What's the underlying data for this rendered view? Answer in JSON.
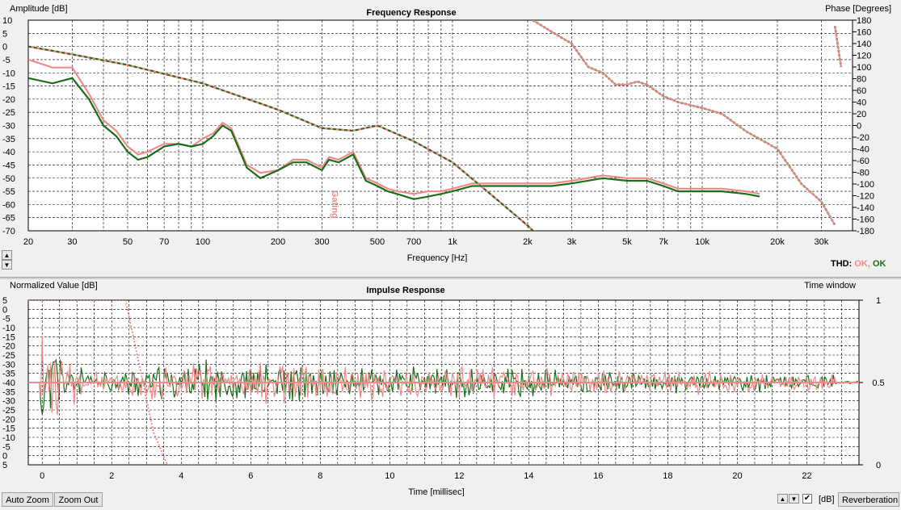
{
  "colors": {
    "series_a": "#f08a8a",
    "series_b": "#1a6e1a",
    "grid": "#000000",
    "background": "#ffffff",
    "window": "#f08a8a",
    "thd_ok_a": "#f08a8a",
    "thd_ok_b": "#1a6e1a"
  },
  "freq": {
    "title": "Frequency Response",
    "ylabel": "Amplitude [dB]",
    "ylabel_right": "Phase [Degrees]",
    "xlabel": "Frequency [Hz]",
    "y_ticks": [
      "10",
      "5",
      "0",
      "-5",
      "-10",
      "-15",
      "-20",
      "-25",
      "-30",
      "-35",
      "-40",
      "-45",
      "-50",
      "-55",
      "-60",
      "-65",
      "-70"
    ],
    "phase_ticks": [
      "180",
      "160",
      "140",
      "120",
      "100",
      "80",
      "60",
      "40",
      "20",
      "0",
      "-20",
      "-40",
      "-60",
      "-80",
      "-100",
      "-120",
      "-140",
      "-160",
      "-180"
    ],
    "x_ticks": [
      "20",
      "30",
      "50",
      "70",
      "100",
      "200",
      "300",
      "500",
      "700",
      "1k",
      "2k",
      "3k",
      "5k",
      "7k",
      "10k",
      "20k",
      "30k"
    ],
    "marker_label": "Gating",
    "thd_label": "THD:",
    "thd_a": "OK,",
    "thd_b": "OK"
  },
  "impulse": {
    "title": "Impulse Response",
    "ylabel": "Normalized Value [dB]",
    "ylabel_right": "Time window",
    "xlabel": "Time [millisec]",
    "y_ticks": [
      "5",
      "0",
      "-5",
      "-10",
      "-15",
      "-20",
      "-25",
      "-30",
      "-35",
      "-40",
      "-35",
      "-30",
      "-25",
      "-20",
      "-15",
      "-10",
      "-5",
      "0",
      "5"
    ],
    "right_ticks": [
      "1",
      "0.5",
      "0"
    ],
    "x_ticks": [
      "0",
      "2",
      "4",
      "6",
      "8",
      "10",
      "12",
      "14",
      "16",
      "18",
      "20",
      "22"
    ]
  },
  "controls": {
    "auto_zoom": "Auto Zoom",
    "zoom_out": "Zoom Out",
    "db_label": "[dB]",
    "reverberation": "Reverberation",
    "up_arrow": "▲",
    "down_arrow": "▼",
    "check": "✔"
  },
  "chart_data": [
    {
      "type": "line",
      "title": "Frequency Response",
      "xlabel": "Frequency [Hz]",
      "ylabel": "Amplitude [dB]",
      "y2label": "Phase [Degrees]",
      "xscale": "log",
      "xlim": [
        20,
        40000
      ],
      "ylim": [
        -70,
        10
      ],
      "y2lim": [
        -180,
        180
      ],
      "grid": true,
      "series": [
        {
          "role": "magnitude_a",
          "color": "#f08a8a",
          "x": [
            20,
            25,
            30,
            35,
            40,
            45,
            50,
            55,
            60,
            70,
            80,
            90,
            100,
            110,
            120,
            130,
            150,
            170,
            200,
            230,
            260,
            300,
            320,
            350,
            400,
            450,
            500,
            550,
            600,
            700,
            800,
            900,
            1000,
            1200,
            1500,
            2000,
            2500,
            3000,
            4000,
            5000,
            6000,
            7000,
            8000,
            10000,
            12000,
            15000,
            17000
          ],
          "y": [
            -5,
            -8,
            -8,
            -18,
            -28,
            -32,
            -38,
            -41,
            -40,
            -37,
            -37,
            -38,
            -35,
            -33,
            -29,
            -31,
            -45,
            -48,
            -47,
            -43,
            -43,
            -46,
            -42,
            -43,
            -40,
            -50,
            -52,
            -54,
            -55,
            -56,
            -55,
            -55,
            -54,
            -52,
            -52,
            -52,
            -52,
            -51,
            -49,
            -50,
            -50,
            -52,
            -54,
            -54,
            -54,
            -55,
            -56
          ]
        },
        {
          "role": "magnitude_b",
          "color": "#1a6e1a",
          "x": [
            20,
            25,
            30,
            35,
            40,
            45,
            50,
            55,
            60,
            70,
            80,
            90,
            100,
            110,
            120,
            130,
            150,
            170,
            200,
            230,
            260,
            300,
            320,
            350,
            400,
            450,
            500,
            550,
            600,
            700,
            800,
            900,
            1000,
            1200,
            1500,
            2000,
            2500,
            3000,
            4000,
            5000,
            6000,
            7000,
            8000,
            10000,
            12000,
            15000,
            17000
          ],
          "y": [
            -12,
            -14,
            -12,
            -20,
            -30,
            -34,
            -40,
            -43,
            -42,
            -38,
            -37,
            -38,
            -37,
            -34,
            -30,
            -32,
            -46,
            -50,
            -47,
            -44,
            -44,
            -47,
            -43,
            -44,
            -41,
            -51,
            -53,
            -55,
            -56,
            -58,
            -57,
            -56,
            -55,
            -53,
            -53,
            -53,
            -53,
            -52,
            -50,
            -51,
            -51,
            -53,
            -55,
            -55,
            -55,
            -56,
            -57
          ]
        },
        {
          "role": "magnitude_smooth",
          "color": "#1a6e1a",
          "dashed": true,
          "x": [
            20,
            30,
            50,
            100,
            200,
            300,
            400,
            500,
            700,
            1000,
            1500,
            2000,
            2100
          ],
          "y": [
            0,
            -3,
            -7,
            -14,
            -24,
            -31,
            -32,
            -30,
            -36,
            -44,
            -58,
            -68,
            -70
          ]
        },
        {
          "role": "phase",
          "color": "#f08a8a",
          "axis": "right",
          "x": [
            2100,
            2500,
            3000,
            3500,
            4000,
            4500,
            5000,
            5500,
            6000,
            7000,
            8000,
            10000,
            12000,
            15000,
            20000,
            25000,
            30000,
            34000
          ],
          "y": [
            180,
            160,
            140,
            100,
            90,
            70,
            70,
            75,
            70,
            50,
            40,
            30,
            20,
            -10,
            -40,
            -100,
            -130,
            -170
          ]
        },
        {
          "role": "phase_tail",
          "color": "#f08a8a",
          "axis": "right",
          "x": [
            34000,
            36000
          ],
          "y": [
            170,
            100
          ]
        }
      ]
    },
    {
      "type": "line",
      "title": "Impulse Response",
      "xlabel": "Time [millisec]",
      "ylabel": "Normalized Value [dB]",
      "y2label": "Time window",
      "xlim": [
        -0.4,
        23.5
      ],
      "y2lim": [
        0,
        1
      ],
      "grid": true,
      "series": [
        {
          "role": "time_window",
          "color": "#f08a8a",
          "axis": "right",
          "x": [
            -0.4,
            2.4,
            2.8,
            3.2,
            3.6,
            23.5
          ],
          "y": [
            1,
            1,
            0.6,
            0.2,
            0,
            0
          ]
        }
      ]
    }
  ]
}
